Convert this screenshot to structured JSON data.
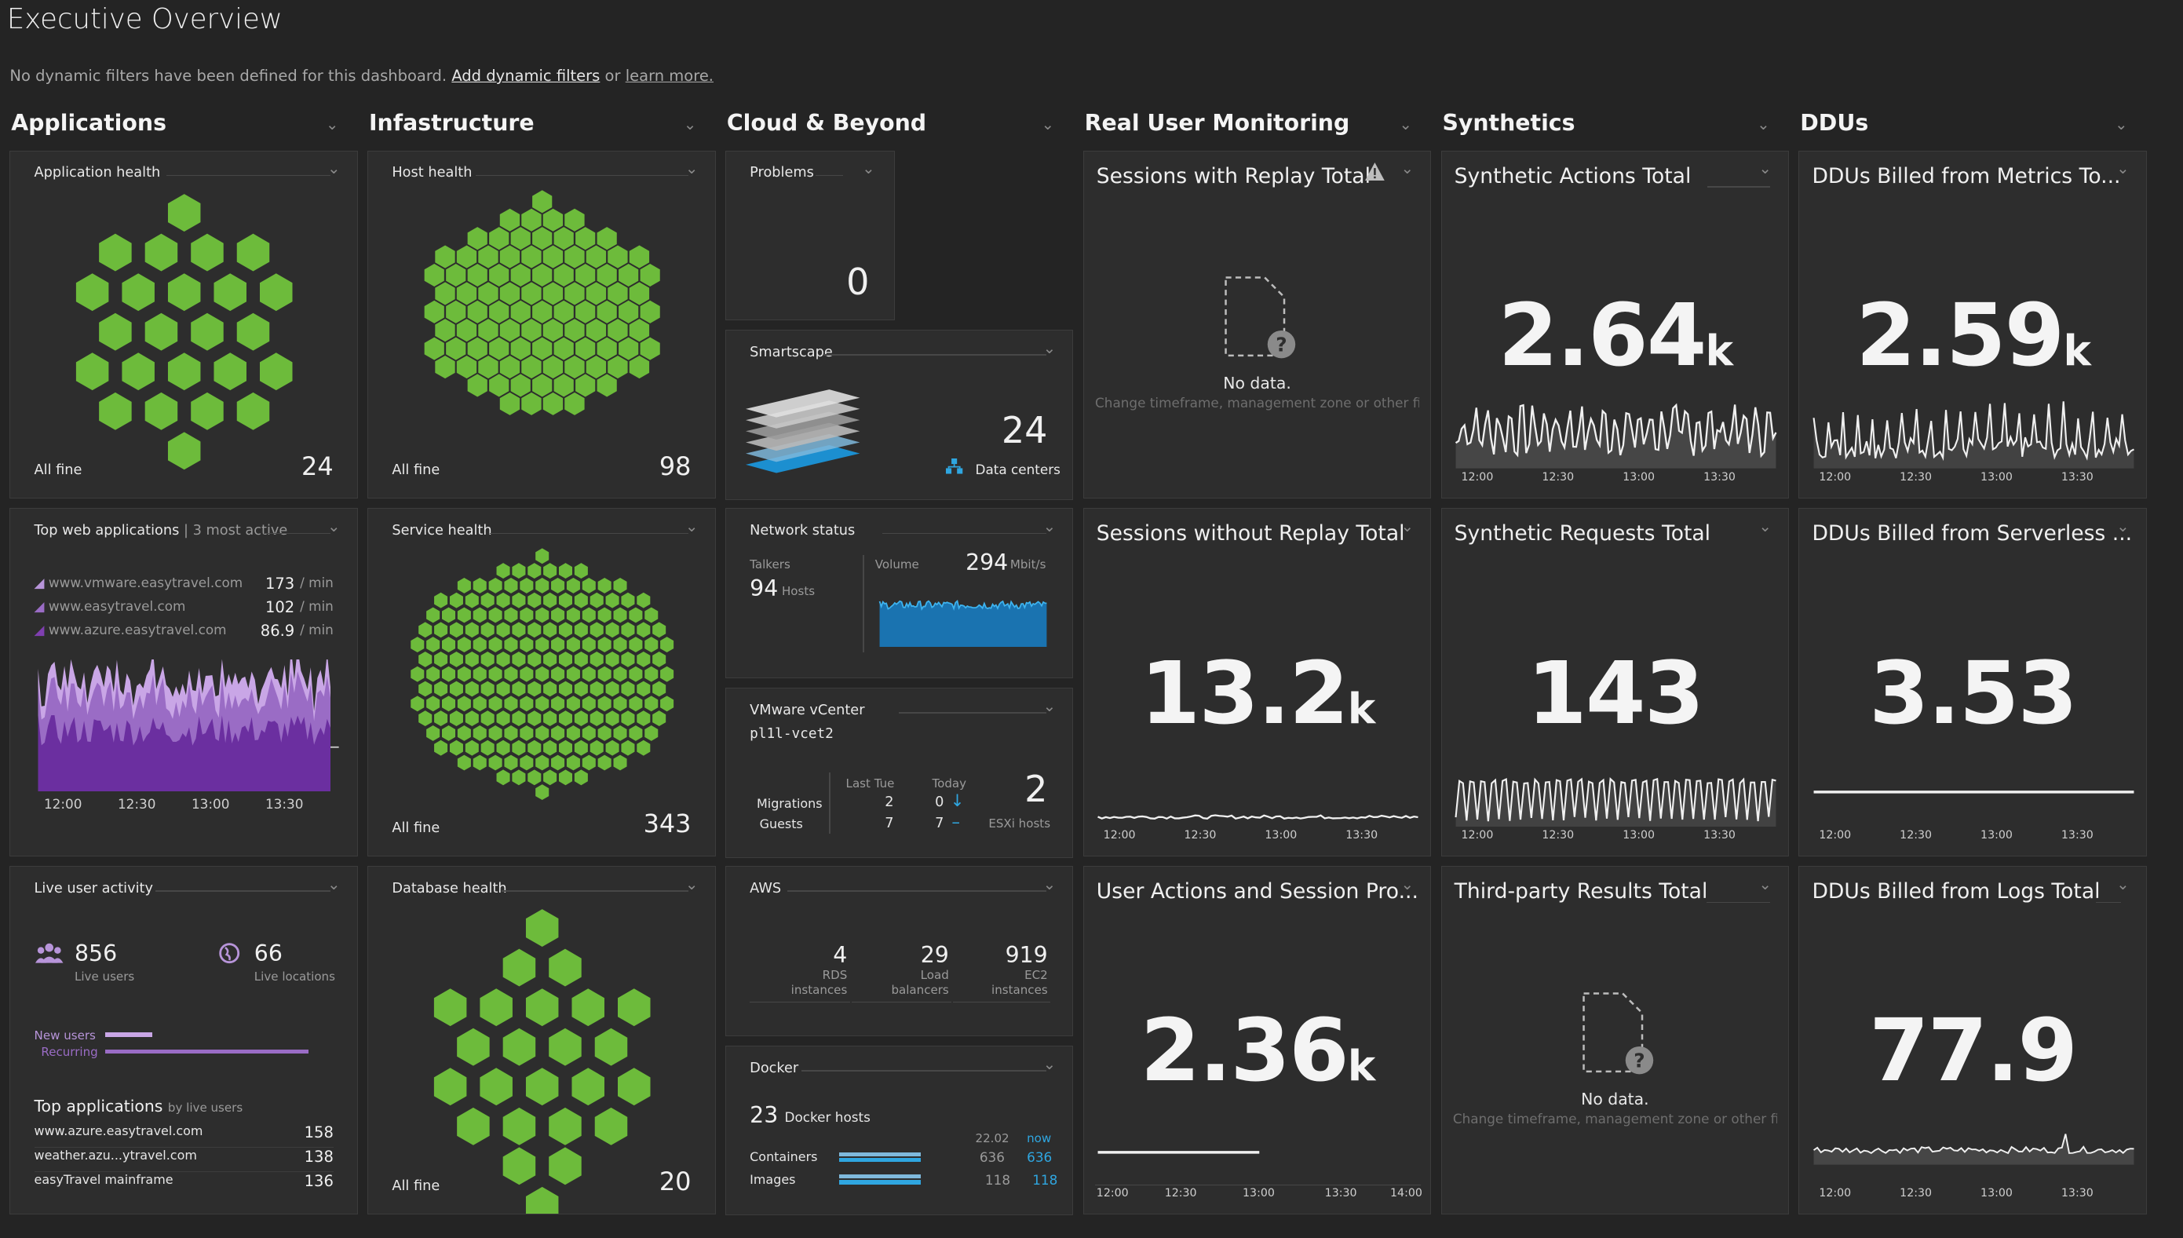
{
  "header": {
    "title": "Executive Overview",
    "filters_text": "No dynamic filters have been defined for this dashboard.",
    "add_filters_link": "Add dynamic filters",
    "or_text": "or",
    "learn_more_link": "learn more."
  },
  "columns": [
    "Applications",
    "Infastructure",
    "Cloud & Beyond",
    "Real User Monitoring",
    "Synthetics",
    "DDUs"
  ],
  "colors": {
    "background": "#242424",
    "tile": "#2d2d2d",
    "health_green": "#6dbb3b",
    "purple": "#7f3fb0",
    "lavender": "#b794d9",
    "blue": "#2fa6e0"
  },
  "app_health": {
    "title": "Application health",
    "status": "All fine",
    "count": "24"
  },
  "host_health": {
    "title": "Host health",
    "status": "All fine",
    "count": "98"
  },
  "service_health": {
    "title": "Service health",
    "status": "All fine",
    "count": "343"
  },
  "database_health": {
    "title": "Database health",
    "status": "All fine",
    "count": "20"
  },
  "top_web_apps": {
    "title": "Top web applications",
    "subtitle": "3 most active",
    "rows": [
      {
        "name": "www.vmware.easytravel.com",
        "value": "173",
        "unit": "/ min"
      },
      {
        "name": "www.easytravel.com",
        "value": "102",
        "unit": "/ min"
      },
      {
        "name": "www.azure.easytravel.com",
        "value": "86.9",
        "unit": "/ min"
      }
    ],
    "times": [
      "12:00",
      "12:30",
      "13:00",
      "13:30"
    ]
  },
  "live_user_activity": {
    "title": "Live user activity",
    "live_users": "856",
    "live_users_label": "Live users",
    "live_locations": "66",
    "live_locations_label": "Live locations",
    "new_users_label": "New users",
    "recurring_label": "Recurring",
    "new_users_share": 0.17,
    "recurring_share": 0.68,
    "top_apps_title": "Top applications",
    "top_apps_sub": "by live users",
    "top_apps": [
      {
        "name": "www.azure.easytravel.com",
        "value": "158"
      },
      {
        "name": "weather.azu...ytravel.com",
        "value": "138"
      },
      {
        "name": "easyTravel mainframe",
        "value": "136"
      }
    ]
  },
  "problems": {
    "title": "Problems",
    "value": "0"
  },
  "smartscape": {
    "title": "Smartscape",
    "value": "24",
    "label": "Data centers"
  },
  "network": {
    "title": "Network status",
    "talkers_label": "Talkers",
    "talkers": "94",
    "talkers_unit": "Hosts",
    "volume_label": "Volume",
    "volume": "294",
    "volume_unit": "Mbit/s"
  },
  "vcenter": {
    "title": "VMware vCenter",
    "host": "pl1l-vcet2",
    "col_last": "Last Tue",
    "col_today": "Today",
    "rows": [
      {
        "label": "Migrations",
        "last": "2",
        "today": "0"
      },
      {
        "label": "Guests",
        "last": "7",
        "today": "7"
      }
    ],
    "esxi": "2",
    "esxi_label": "ESXi hosts"
  },
  "aws": {
    "title": "AWS",
    "items": [
      {
        "value": "4",
        "label1": "RDS",
        "label2": "instances"
      },
      {
        "value": "29",
        "label1": "Load",
        "label2": "balancers"
      },
      {
        "value": "919",
        "label1": "EC2",
        "label2": "instances"
      }
    ]
  },
  "docker": {
    "title": "Docker",
    "hosts": "23",
    "hosts_label": "Docker hosts",
    "col_date": "22.02",
    "col_now": "now",
    "rows": [
      {
        "label": "Containers",
        "past": "636",
        "now": "636"
      },
      {
        "label": "Images",
        "past": "118",
        "now": "118"
      }
    ]
  },
  "rum": {
    "sessions_replay": {
      "title": "Sessions with Replay Total",
      "no_data": "No data.",
      "no_data_hint": "Change timeframe, management zone or other fi..."
    },
    "sessions_no_replay": {
      "title": "Sessions without Replay Total",
      "value": "13.2",
      "unit": "k",
      "times": [
        "12:00",
        "12:30",
        "13:00",
        "13:30"
      ]
    },
    "user_actions": {
      "title": "User Actions and Session Pro...",
      "value": "2.36",
      "unit": "k",
      "times": [
        "12:00",
        "12:30",
        "13:00",
        "13:30",
        "14:00"
      ]
    }
  },
  "synthetics": {
    "actions": {
      "title": "Synthetic Actions Total",
      "value": "2.64",
      "unit": "k",
      "times": [
        "12:00",
        "12:30",
        "13:00",
        "13:30"
      ]
    },
    "requests": {
      "title": "Synthetic Requests Total",
      "value": "143",
      "unit": "",
      "times": [
        "12:00",
        "12:30",
        "13:00",
        "13:30"
      ]
    },
    "third_party": {
      "title": "Third-party Results Total",
      "no_data": "No data.",
      "no_data_hint": "Change timeframe, management zone or other fi..."
    }
  },
  "ddus": {
    "metrics": {
      "title": "DDUs Billed from Metrics To...",
      "value": "2.59",
      "unit": "k",
      "times": [
        "12:00",
        "12:30",
        "13:00",
        "13:30"
      ]
    },
    "serverless": {
      "title": "DDUs Billed from Serverless ...",
      "value": "3.53",
      "unit": "",
      "times": [
        "12:00",
        "12:30",
        "13:00",
        "13:30"
      ]
    },
    "logs": {
      "title": "DDUs Billed from Logs Total",
      "value": "77.9",
      "unit": "",
      "times": [
        "12:00",
        "12:30",
        "13:00",
        "13:30"
      ]
    }
  }
}
